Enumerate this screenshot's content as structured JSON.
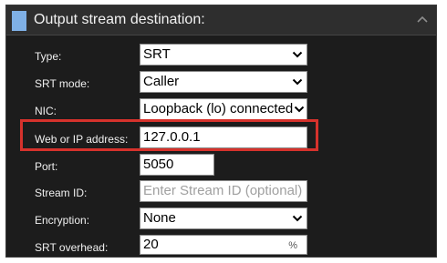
{
  "header": {
    "title": "Output stream destination:",
    "collapse_icon": "chevron-up-icon"
  },
  "fields": {
    "type": {
      "label": "Type:",
      "value": "SRT"
    },
    "srt_mode": {
      "label": "SRT mode:",
      "value": "Caller"
    },
    "nic": {
      "label": "NIC:",
      "value": "Loopback (lo) connected"
    },
    "address": {
      "label": "Web or IP address:",
      "value": "127.0.0.1"
    },
    "port": {
      "label": "Port:",
      "value": "5050"
    },
    "stream_id": {
      "label": "Stream ID:",
      "value": "",
      "placeholder": "Enter Stream ID (optional)"
    },
    "encryption": {
      "label": "Encryption:",
      "value": "None"
    },
    "srt_overhead": {
      "label": "SRT overhead:",
      "value": "20",
      "unit": "%"
    }
  },
  "colors": {
    "panel_bg": "#1c1c1c",
    "header_bg": "#2e2e2e",
    "accent": "#7fb0e6",
    "highlight": "#d6322c"
  }
}
